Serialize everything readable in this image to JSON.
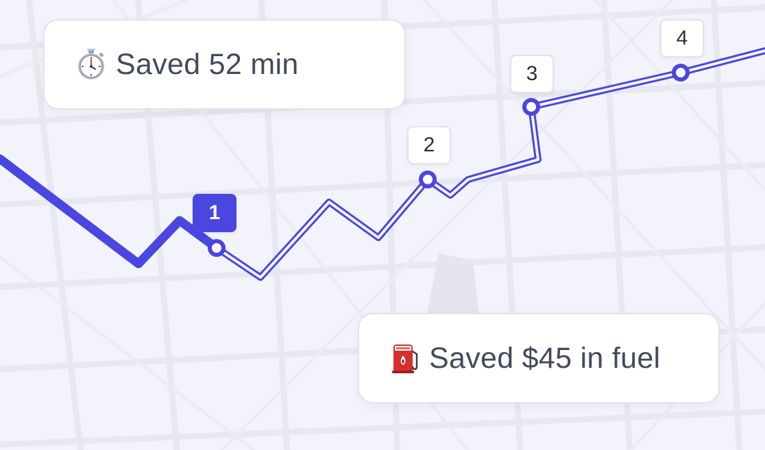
{
  "colors": {
    "background": "#f3f4fb",
    "streets": "#e6e7ef",
    "route": "#4a46e0",
    "card_text": "#424a5c"
  },
  "stats": [
    {
      "icon": "stopwatch-icon",
      "text": "Saved 52 min"
    },
    {
      "icon": "fuel-pump-icon",
      "text": "Saved $45 in fuel"
    }
  ],
  "route": {
    "stops": [
      {
        "label": "1",
        "status": "completed"
      },
      {
        "label": "2",
        "status": "upcoming"
      },
      {
        "label": "3",
        "status": "upcoming"
      },
      {
        "label": "4",
        "status": "upcoming"
      }
    ]
  }
}
